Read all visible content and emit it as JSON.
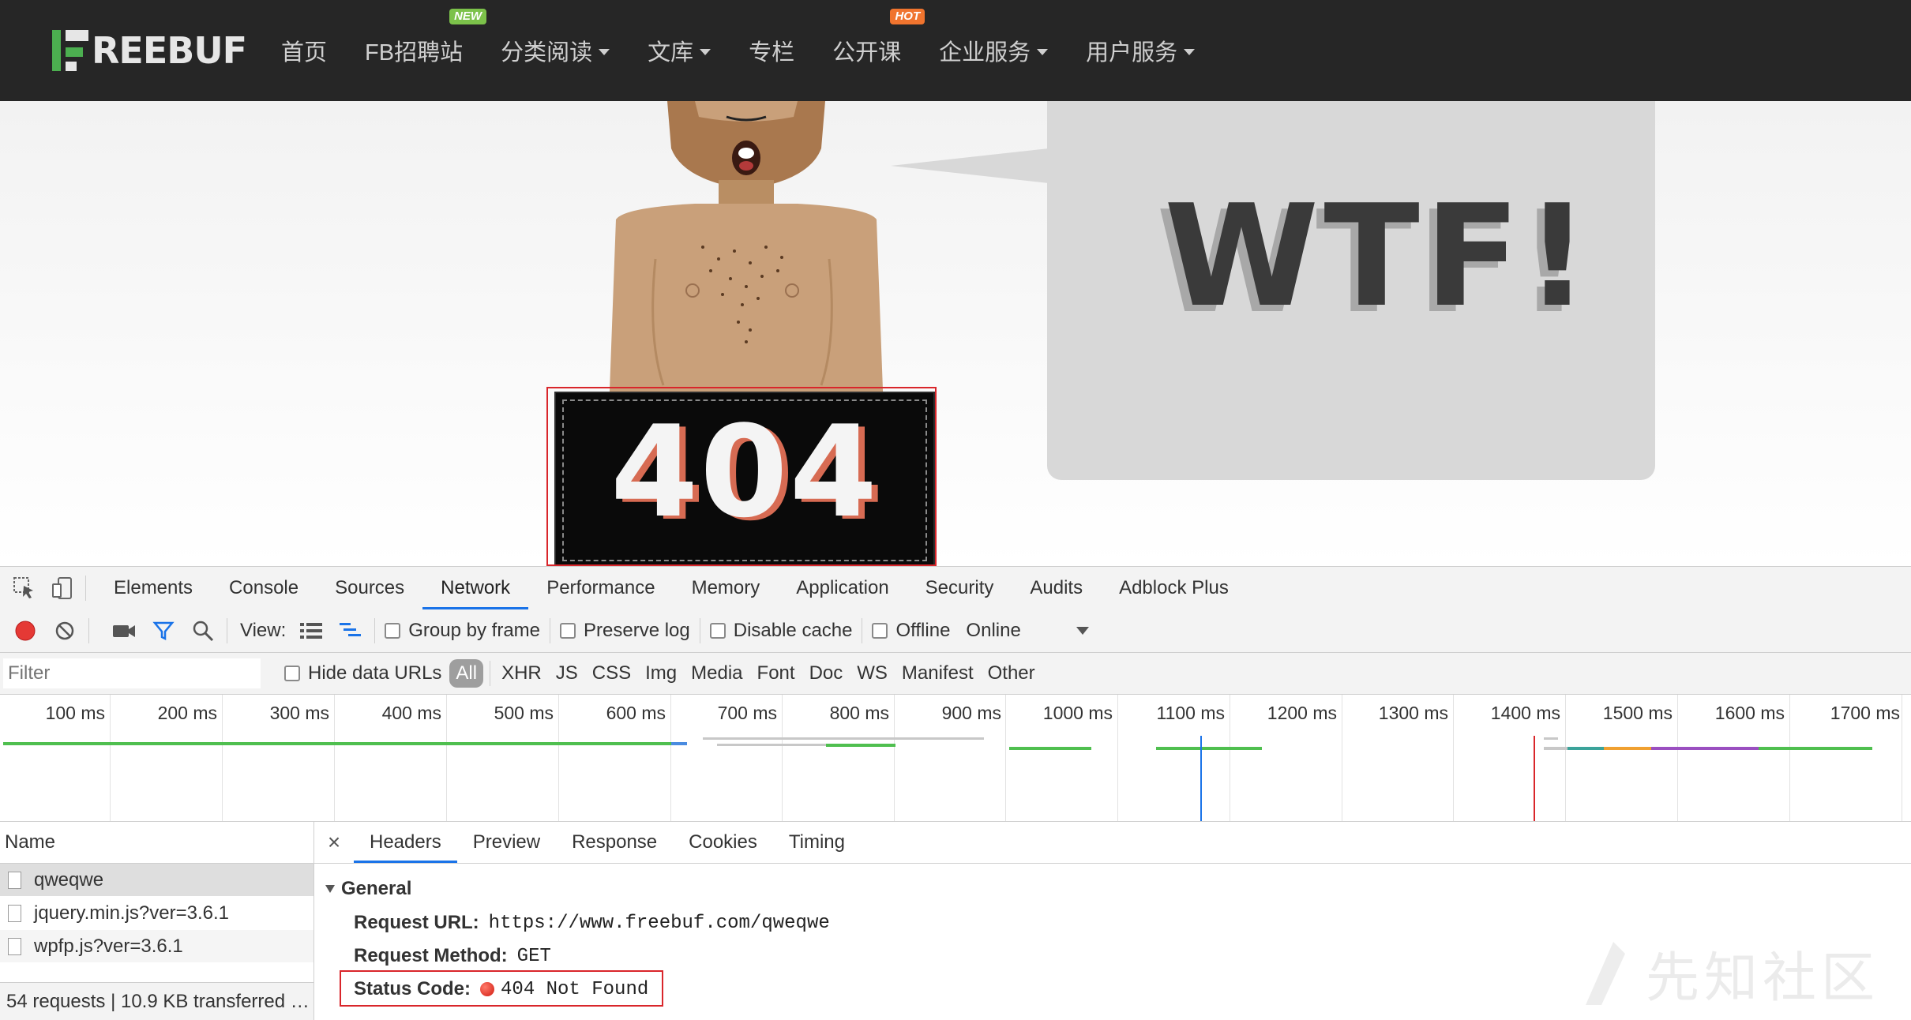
{
  "site": {
    "logo_text": "REEBUF",
    "nav": [
      {
        "label": "首页"
      },
      {
        "label": "FB招聘站",
        "badge": "NEW"
      },
      {
        "label": "分类阅读"
      },
      {
        "label": "文库"
      },
      {
        "label": "专栏"
      },
      {
        "label": "公开课",
        "badge": "HOT"
      },
      {
        "label": "企业服务"
      },
      {
        "label": "用户服务"
      }
    ]
  },
  "hero": {
    "bubble_text": "WTF!",
    "sign_text": "404"
  },
  "devtools": {
    "tabs": [
      "Elements",
      "Console",
      "Sources",
      "Network",
      "Performance",
      "Memory",
      "Application",
      "Security",
      "Audits",
      "Adblock Plus"
    ],
    "active_tab": "Network",
    "toolbar": {
      "view_label": "View:",
      "group_by_frame": "Group by frame",
      "preserve_log": "Preserve log",
      "disable_cache": "Disable cache",
      "offline": "Offline",
      "throttle": "Online"
    },
    "filterbar": {
      "filter_placeholder": "Filter",
      "hide_data_urls": "Hide data URLs",
      "types": [
        "All",
        "XHR",
        "JS",
        "CSS",
        "Img",
        "Media",
        "Font",
        "Doc",
        "WS",
        "Manifest",
        "Other"
      ]
    },
    "timeline": {
      "ticks": [
        "100 ms",
        "200 ms",
        "300 ms",
        "400 ms",
        "500 ms",
        "600 ms",
        "700 ms",
        "800 ms",
        "900 ms",
        "1000 ms",
        "1100 ms",
        "1200 ms",
        "1300 ms",
        "1400 ms",
        "1500 ms",
        "1600 ms",
        "1700 ms"
      ]
    },
    "requests": {
      "header": "Name",
      "rows": [
        "qweqwe",
        "jquery.min.js?ver=3.6.1",
        "wpfp.js?ver=3.6.1"
      ],
      "summary": "54 requests | 10.9 KB transferred …"
    },
    "detail": {
      "close": "×",
      "tabs": [
        "Headers",
        "Preview",
        "Response",
        "Cookies",
        "Timing"
      ],
      "section": "General",
      "request_url_label": "Request URL:",
      "request_url": "https://www.freebuf.com/qweqwe",
      "request_method_label": "Request Method:",
      "request_method": "GET",
      "status_code_label": "Status Code:",
      "status_code": "404 Not Found"
    },
    "watermark": "先知社区"
  },
  "colors": {
    "accent_green": "#4caf50",
    "highlight_red": "#d9262b",
    "devtools_blue": "#1a73e8"
  }
}
